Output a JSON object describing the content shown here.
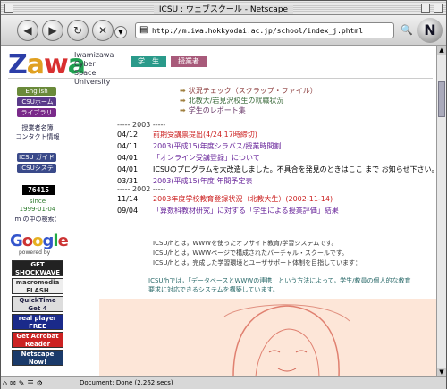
{
  "window": {
    "title": "ICSU : ウェブスクール - Netscape"
  },
  "toolbar": {
    "url": "http://m.iwa.hokkyodai.ac.jp/school/index_j.phtml",
    "nav_logo": "N"
  },
  "status": {
    "text": "Document: Done (2.262 secs)"
  },
  "header": {
    "logo": [
      "Z",
      "a",
      "w",
      "a"
    ],
    "cyber": [
      "Iwamizawa",
      "Cyber",
      "Space",
      "University"
    ],
    "tab_student": "学　生",
    "tab_teacher": "授業者"
  },
  "sidebar": {
    "english": "English",
    "home": "ICSUホーム",
    "library": "ライブラリ",
    "staff": "授業者名簿",
    "contact": "コンタクト情報",
    "guide": "ICSU ガイド",
    "system": "ICSUシステム",
    "counter": "76415",
    "since_label": "since",
    "since_date": "1999-01-04",
    "search_label": "m の中の検索：",
    "google_sub": "powered by",
    "badges": [
      "GET SHOCKWAVE",
      "macromedia FLASH PLAYER",
      "QuickTime Get 4",
      "real player FREE",
      "Get Acrobat Reader",
      "Netscape Now!"
    ]
  },
  "toplinks": [
    "状況チェック（スクラップ・ファイル）",
    "北教大/岩見沢校生の就職状況",
    "学生のレポート集"
  ],
  "section_2003": "----- 2003 -----",
  "news2003": [
    {
      "date": "04/12",
      "text": "前期受講票提出(4/24,17時締切)",
      "color": "#cc2222"
    },
    {
      "date": "04/11",
      "text": "2003(平成15)年度シラバス/授業時間割",
      "color": "#662299"
    },
    {
      "date": "04/01",
      "text": "「オンライン受講登録」について",
      "color": "#662299"
    },
    {
      "date": "04/01",
      "text": "ICSUのプログラムを大改造しました。不具合を発見のときはここ まで お知らせ下さい。",
      "color": "#000000"
    },
    {
      "date": "03/31",
      "text": "2003(平成15)年度 年間予定表",
      "color": "#662299"
    }
  ],
  "section_2002": "----- 2002 -----",
  "news2002": [
    {
      "date": "11/14",
      "text": "2003年度学校教育登録状況（北教大生）(2002-11-14)",
      "color": "#cc2222"
    },
    {
      "date": "09/04",
      "text": "「算数科教材研究」に対する「学生による授業評価」結果",
      "color": "#662299"
    }
  ],
  "info": [
    "ICSU/hとは，WWWを使ったオフサイト教育/学習システムです。",
    "ICSU/hとは，WWWページで構成されたバーチャル・スクールです。",
    "ICSU/hとは，完成した学習環境とユーザサポート体制を目指しています："
  ],
  "desc": "ICSU/hでは，「データベースとWWWの連携」という方法によって，学生/教員の個人的な教育要求に対応できるシステムを構築しています。"
}
